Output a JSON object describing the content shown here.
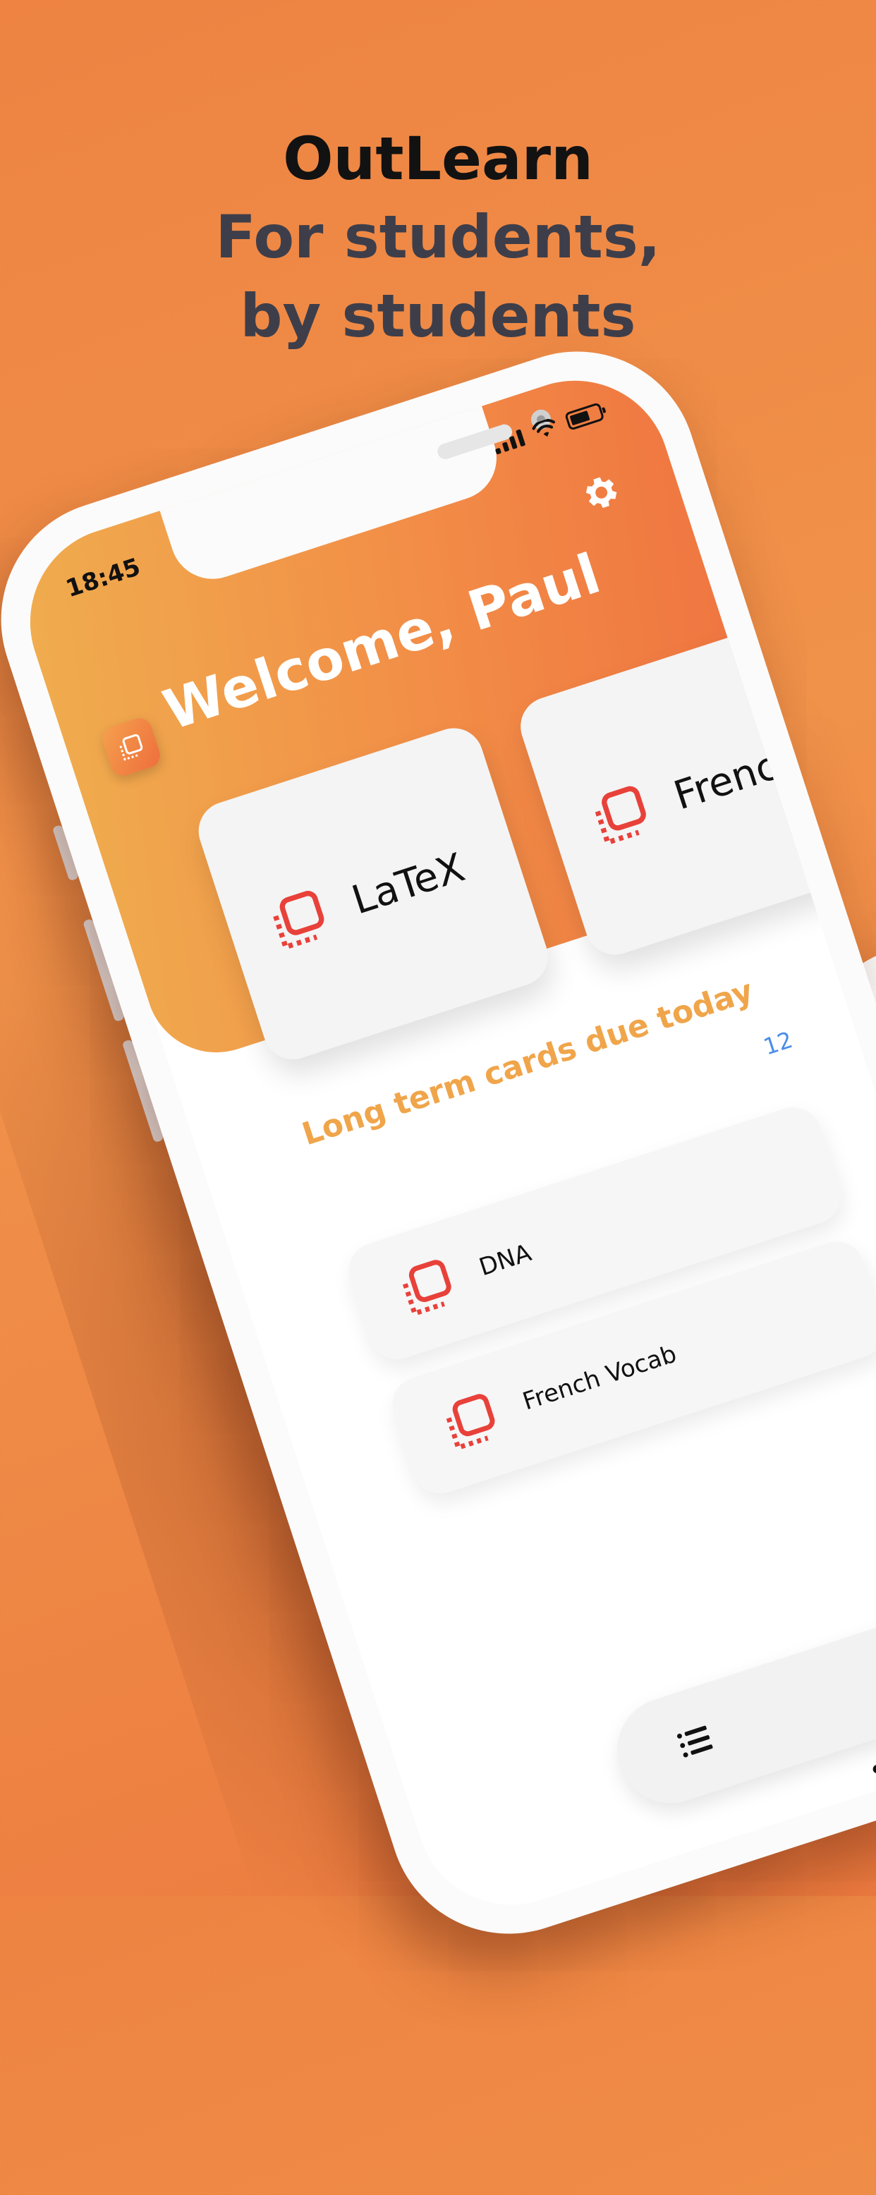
{
  "headline": {
    "title": "OutLearn",
    "subtitle_line1": "For students,",
    "subtitle_line2": "by students"
  },
  "status_bar": {
    "time": "18:45"
  },
  "header": {
    "welcome": "Welcome, Paul"
  },
  "decks": [
    {
      "label": "LaTeX",
      "icon": "flashcard-deck-icon"
    },
    {
      "label": "French V",
      "icon": "flashcard-deck-icon"
    }
  ],
  "due_section": {
    "title": "Long term cards due today",
    "count": "12"
  },
  "due_list": [
    {
      "label": "DNA",
      "icon": "flashcard-deck-icon"
    },
    {
      "label": "French Vocab",
      "icon": "flashcard-deck-icon"
    }
  ],
  "icons": {
    "settings": "gear-icon",
    "tab": "list-icon"
  },
  "colors": {
    "background": "#ee8342",
    "header_gradient_start": "#f0ad4e",
    "header_gradient_end": "#ef7340",
    "section_title": "#f0a54a",
    "deck_icon": "#e8413a",
    "count": "#4a8ee8"
  }
}
